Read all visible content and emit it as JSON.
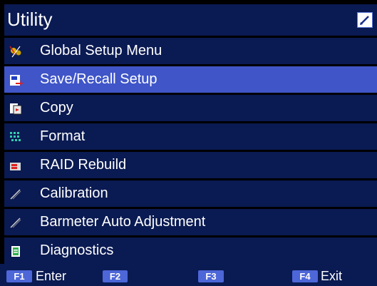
{
  "title": "Utility",
  "title_icon": "edit-icon",
  "menu": [
    {
      "label": "Global Setup Menu",
      "icon": "setup-icon",
      "selected": false
    },
    {
      "label": "Save/Recall Setup",
      "icon": "save-recall-icon",
      "selected": true
    },
    {
      "label": "Copy",
      "icon": "copy-icon",
      "selected": false
    },
    {
      "label": "Format",
      "icon": "format-icon",
      "selected": false
    },
    {
      "label": "RAID Rebuild",
      "icon": "raid-icon",
      "selected": false
    },
    {
      "label": "Calibration",
      "icon": "pen-icon",
      "selected": false
    },
    {
      "label": "Barmeter Auto Adjustment",
      "icon": "pen-icon",
      "selected": false
    },
    {
      "label": "Diagnostics",
      "icon": "clipboard-icon",
      "selected": false
    }
  ],
  "footer": {
    "f1": {
      "key": "F1",
      "label": "Enter"
    },
    "f2": {
      "key": "F2",
      "label": ""
    },
    "f3": {
      "key": "F3",
      "label": ""
    },
    "f4": {
      "key": "F4",
      "label": "Exit"
    }
  },
  "colors": {
    "background": "#000000",
    "bar": "#0a1a52",
    "selected": "#3f55c8",
    "key": "#4d66d8"
  }
}
